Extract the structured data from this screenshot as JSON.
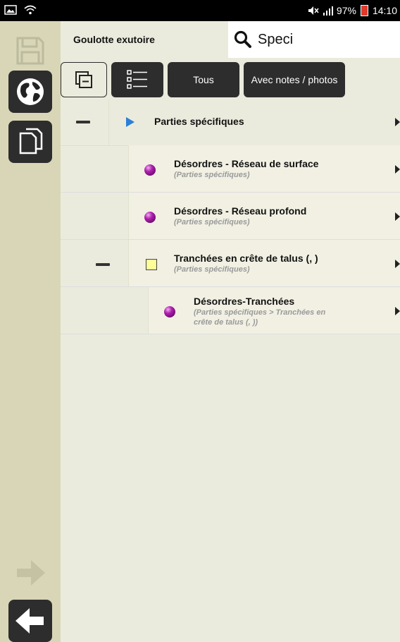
{
  "status_bar": {
    "battery_percent": "97%",
    "time": "14:10"
  },
  "header": {
    "title": "Goulotte exutoire",
    "search_value": "Speci"
  },
  "toolbar": {
    "tous_label": "Tous",
    "notes_label": "Avec notes / photos"
  },
  "tree": [
    {
      "title": "Parties spécifiques",
      "subtitle": "",
      "icon": "blue-triangle-icon"
    },
    {
      "title": "Désordres - Réseau de surface",
      "subtitle": "(Parties spécifiques)",
      "icon": "purple-sphere-icon"
    },
    {
      "title": "Désordres - Réseau profond",
      "subtitle": "(Parties spécifiques)",
      "icon": "purple-sphere-icon"
    },
    {
      "title": "Tranchées en crête de talus (, )",
      "subtitle": "(Parties spécifiques)",
      "icon": "yellow-square-icon"
    },
    {
      "title": "Désordres-Tranchées",
      "subtitle_line1": "(Parties spécifiques > Tranchées en",
      "subtitle_line2": "crête de talus (, ))",
      "icon": "purple-sphere-icon"
    }
  ],
  "colors": {
    "background": "#ebebdd",
    "sidebar": "#d8d6b6",
    "dark_button": "#2d2d2d",
    "accent_blue": "#2b7fd6",
    "accent_purple": "#b020b0"
  }
}
